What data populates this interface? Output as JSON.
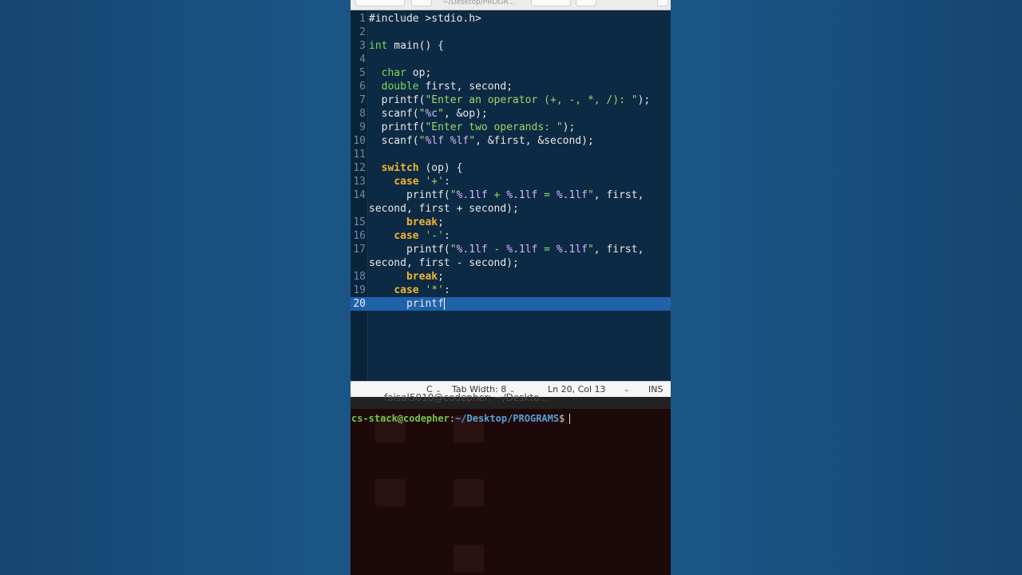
{
  "window": {
    "title": "~/Desktop/PROGR..."
  },
  "editor": {
    "lines": [
      {
        "n": "1",
        "segs": [
          {
            "t": "#include >stdio.h>",
            "c": ""
          }
        ]
      },
      {
        "n": "2",
        "segs": []
      },
      {
        "n": "3",
        "segs": [
          {
            "t": "int",
            "c": "ty"
          },
          {
            "t": " main() {",
            "c": ""
          }
        ]
      },
      {
        "n": "4",
        "segs": []
      },
      {
        "n": "5",
        "segs": [
          {
            "t": "  ",
            "c": ""
          },
          {
            "t": "char",
            "c": "ty"
          },
          {
            "t": " op;",
            "c": ""
          }
        ]
      },
      {
        "n": "6",
        "segs": [
          {
            "t": "  ",
            "c": ""
          },
          {
            "t": "double",
            "c": "ty"
          },
          {
            "t": " first, second;",
            "c": ""
          }
        ]
      },
      {
        "n": "7",
        "segs": [
          {
            "t": "  printf(",
            "c": ""
          },
          {
            "t": "\"Enter an operator (+, -, *, /): \"",
            "c": "str"
          },
          {
            "t": ");",
            "c": ""
          }
        ]
      },
      {
        "n": "8",
        "segs": [
          {
            "t": "  scanf(",
            "c": ""
          },
          {
            "t": "\"",
            "c": "str"
          },
          {
            "t": "%c",
            "c": "fmt"
          },
          {
            "t": "\"",
            "c": "str"
          },
          {
            "t": ", &op);",
            "c": ""
          }
        ]
      },
      {
        "n": "9",
        "segs": [
          {
            "t": "  printf(",
            "c": ""
          },
          {
            "t": "\"Enter two operands: \"",
            "c": "str"
          },
          {
            "t": ");",
            "c": ""
          }
        ]
      },
      {
        "n": "10",
        "segs": [
          {
            "t": "  scanf(",
            "c": ""
          },
          {
            "t": "\"",
            "c": "str"
          },
          {
            "t": "%lf %lf",
            "c": "fmt"
          },
          {
            "t": "\"",
            "c": "str"
          },
          {
            "t": ", &first, &second);",
            "c": ""
          }
        ]
      },
      {
        "n": "11",
        "segs": []
      },
      {
        "n": "12",
        "segs": [
          {
            "t": "  ",
            "c": ""
          },
          {
            "t": "switch",
            "c": "kw"
          },
          {
            "t": " (op) {",
            "c": ""
          }
        ]
      },
      {
        "n": "13",
        "segs": [
          {
            "t": "    ",
            "c": ""
          },
          {
            "t": "case",
            "c": "kw"
          },
          {
            "t": " ",
            "c": ""
          },
          {
            "t": "'+'",
            "c": "str"
          },
          {
            "t": ":",
            "c": ""
          }
        ]
      },
      {
        "n": "14",
        "segs": [
          {
            "t": "      printf(",
            "c": ""
          },
          {
            "t": "\"",
            "c": "str"
          },
          {
            "t": "%.1lf",
            "c": "fmt"
          },
          {
            "t": " + ",
            "c": "str"
          },
          {
            "t": "%.1lf",
            "c": "fmt"
          },
          {
            "t": " = ",
            "c": "str"
          },
          {
            "t": "%.1lf",
            "c": "fmt"
          },
          {
            "t": "\"",
            "c": "str"
          },
          {
            "t": ", first,",
            "c": ""
          }
        ]
      },
      {
        "n": "",
        "segs": [
          {
            "t": "second, first + second);",
            "c": ""
          }
        ]
      },
      {
        "n": "15",
        "segs": [
          {
            "t": "      ",
            "c": ""
          },
          {
            "t": "break",
            "c": "kw"
          },
          {
            "t": ";",
            "c": ""
          }
        ]
      },
      {
        "n": "16",
        "segs": [
          {
            "t": "    ",
            "c": ""
          },
          {
            "t": "case",
            "c": "kw"
          },
          {
            "t": " ",
            "c": ""
          },
          {
            "t": "'-'",
            "c": "str"
          },
          {
            "t": ":",
            "c": ""
          }
        ]
      },
      {
        "n": "17",
        "segs": [
          {
            "t": "      printf(",
            "c": ""
          },
          {
            "t": "\"",
            "c": "str"
          },
          {
            "t": "%.1lf",
            "c": "fmt"
          },
          {
            "t": " - ",
            "c": "str"
          },
          {
            "t": "%.1lf",
            "c": "fmt"
          },
          {
            "t": " = ",
            "c": "str"
          },
          {
            "t": "%.1lf",
            "c": "fmt"
          },
          {
            "t": "\"",
            "c": "str"
          },
          {
            "t": ", first,",
            "c": ""
          }
        ]
      },
      {
        "n": "",
        "segs": [
          {
            "t": "second, first - second);",
            "c": ""
          }
        ]
      },
      {
        "n": "18",
        "segs": [
          {
            "t": "      ",
            "c": ""
          },
          {
            "t": "break",
            "c": "kw"
          },
          {
            "t": ";",
            "c": ""
          }
        ]
      },
      {
        "n": "19",
        "segs": [
          {
            "t": "    ",
            "c": ""
          },
          {
            "t": "case",
            "c": "kw"
          },
          {
            "t": " ",
            "c": ""
          },
          {
            "t": "'*'",
            "c": "str"
          },
          {
            "t": ":",
            "c": ""
          }
        ]
      },
      {
        "n": "20",
        "current": true,
        "segs": [
          {
            "t": "      printf",
            "c": ""
          }
        ]
      }
    ]
  },
  "statusbar": {
    "language": "C",
    "tab_width": "Tab Width: 8",
    "position": "Ln 20, Col 13",
    "mode": "INS"
  },
  "terminal": {
    "tab_title": "faisal5010@codepher: ~/Deskto...",
    "user_host": "cs-stack@codepher",
    "colon": ":",
    "path": "~/Desktop/PROGRAMS",
    "dollar": "$"
  },
  "colors": {
    "editor_bg": "#0d2a44",
    "current_line": "#1f62a9",
    "keyword": "#f0b431",
    "type": "#7ed957",
    "string": "#9bd66a",
    "prompt_user": "#72c44a",
    "prompt_path": "#5a9fd6"
  }
}
